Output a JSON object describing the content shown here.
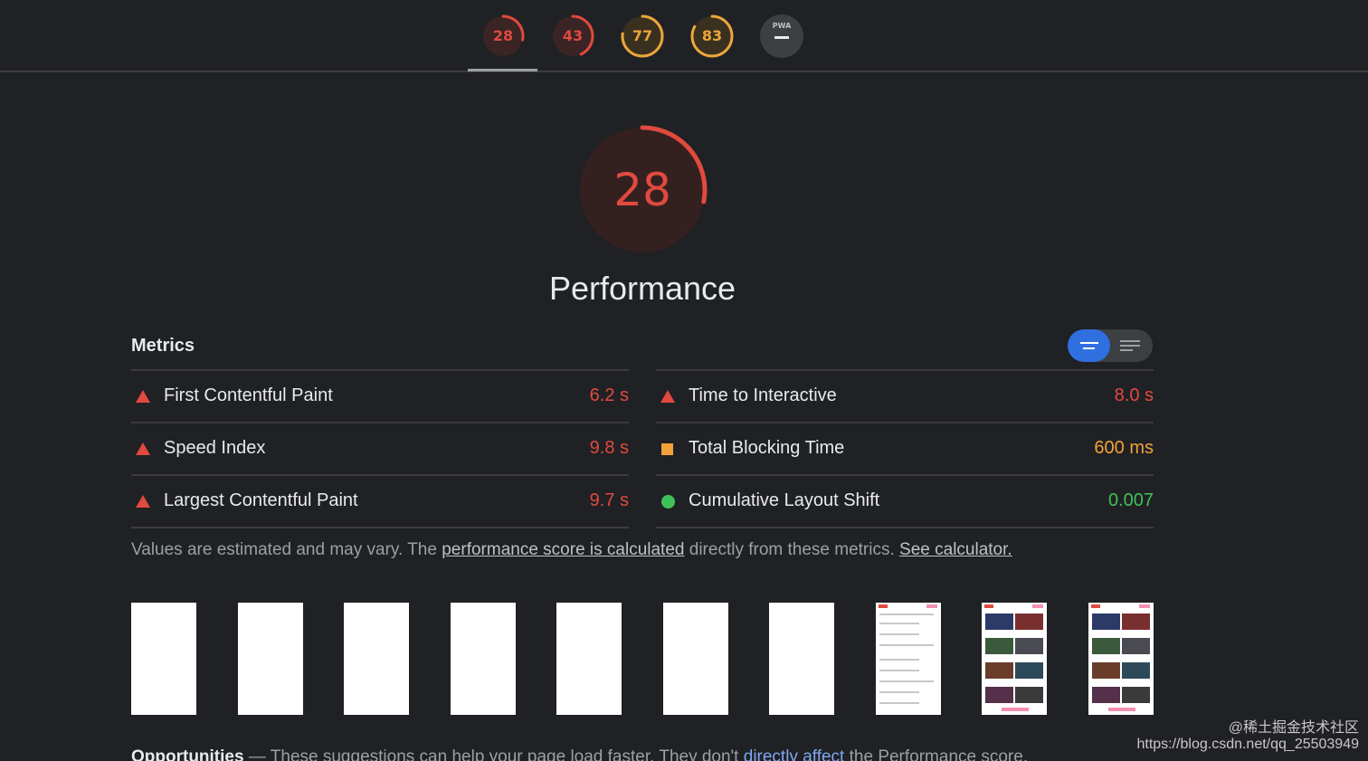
{
  "tabs": [
    {
      "score": "28",
      "color": "#e04a3f",
      "fraction": 0.28
    },
    {
      "score": "43",
      "color": "#e04a3f",
      "fraction": 0.43
    },
    {
      "score": "77",
      "color": "#e9a73a",
      "fraction": 0.77
    },
    {
      "score": "83",
      "color": "#e9a73a",
      "fraction": 0.83
    }
  ],
  "pwa_tab": {
    "label": "PWA"
  },
  "category": {
    "score": "28",
    "fraction": 0.28,
    "color": "#e04a3f",
    "title": "Performance"
  },
  "metrics": {
    "header": "Metrics",
    "left": [
      {
        "label": "First Contentful Paint",
        "value": "6.2 s",
        "status": "fail",
        "color": "#e04a3f"
      },
      {
        "label": "Speed Index",
        "value": "9.8 s",
        "status": "fail",
        "color": "#e04a3f"
      },
      {
        "label": "Largest Contentful Paint",
        "value": "9.7 s",
        "status": "fail",
        "color": "#e04a3f"
      }
    ],
    "right": [
      {
        "label": "Time to Interactive",
        "value": "8.0 s",
        "status": "fail",
        "color": "#e04a3f"
      },
      {
        "label": "Total Blocking Time",
        "value": "600 ms",
        "status": "average",
        "color": "#f2a23a"
      },
      {
        "label": "Cumulative Layout Shift",
        "value": "0.007",
        "status": "pass",
        "color": "#3fc25a"
      }
    ]
  },
  "footnote": {
    "prefix": "Values are estimated and may vary. The ",
    "link1": "performance score is calculated",
    "middle": " directly from these metrics. ",
    "link2": "See calculator."
  },
  "filmstrip": [
    "blank",
    "blank",
    "blank",
    "blank",
    "blank",
    "blank",
    "blank",
    "partial",
    "full",
    "full"
  ],
  "opportunities": {
    "title": "Opportunities",
    "dash": " — ",
    "text1": "These suggestions can help your page load faster. They don't ",
    "link": "directly affect",
    "text2": " the Performance score."
  },
  "watermark": {
    "line1": "@稀土掘金技术社区",
    "line2": "https://blog.csdn.net/qq_25503949"
  }
}
